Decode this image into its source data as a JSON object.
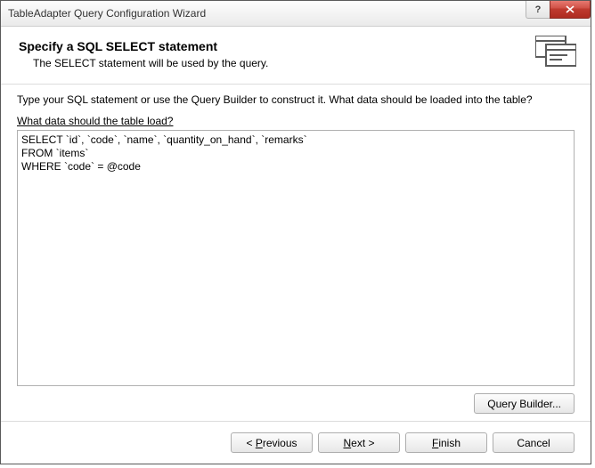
{
  "window": {
    "title": "TableAdapter Query Configuration Wizard"
  },
  "header": {
    "title": "Specify a SQL SELECT statement",
    "subtitle": "The SELECT statement will be used by the query."
  },
  "body": {
    "instruction": "Type your SQL statement or use the Query Builder to construct it. What data should be loaded into the table?",
    "field_label": "What data should the table load?",
    "sql_text": "SELECT `id`, `code`, `name`, `quantity_on_hand`, `remarks`\nFROM `items`\nWHERE `code` = @code",
    "query_builder_label": "Query Builder..."
  },
  "footer": {
    "previous_pre": "< ",
    "previous_key": "P",
    "previous_post": "revious",
    "next_pre": "",
    "next_key": "N",
    "next_post": "ext >",
    "finish_pre": "",
    "finish_key": "F",
    "finish_post": "inish",
    "cancel_label": "Cancel"
  }
}
